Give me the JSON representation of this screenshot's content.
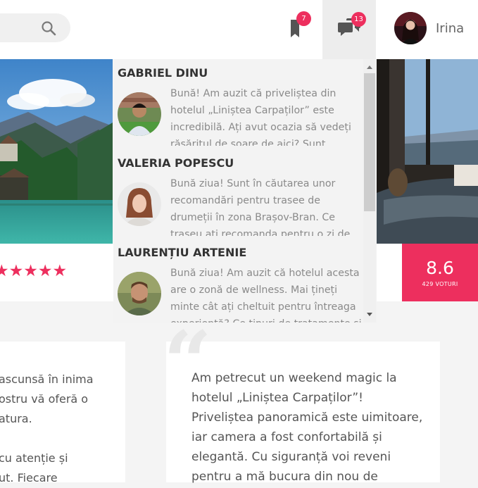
{
  "header": {
    "search_placeholder": "",
    "bookmarks_count": "7",
    "messages_count": "13",
    "user_name": "Irina",
    "accent_color": "#ed2f5e"
  },
  "hotel_card": {
    "rating_stars": "★★★★★",
    "stars_value": 5,
    "score": "8.6",
    "votes": "429 VOTURI"
  },
  "messages": [
    {
      "name": "GABRIEL DINU",
      "text": "Bună! Am auzit că priveliștea din hotelul „Liniștea Carpaților” este incredibilă. Ați avut ocazia să vedeți răsăritul de soare de aici? Sunt indecis"
    },
    {
      "name": "VALERIA POPESCU",
      "text": "Bună ziua! Sunt în căutarea unor recomandări pentru trasee de drumeții în zona Brașov-Bran. Ce traseu ați recomanda pentru o zi de"
    },
    {
      "name": "LAURENȚIU ARTENIE",
      "text": "Bună ziua! Am auzit că hotelul acesta are o zonă de wellness. Mai țineți minte cât ați cheltuit pentru întreaga experiență? Ce tipuri de tratamente și"
    }
  ],
  "reviews": {
    "left_lines": [
      "ascunsă în inima",
      "ostru vă oferă o",
      "atura.",
      "",
      "cu atenție și",
      "ut. Fiecare"
    ],
    "right_text": "Am petrecut un weekend magic la hotelul „Liniștea Carpaților”! Priveliștea panoramică este uimitoare, iar camera a fost confortabilă și elegantă. Cu siguranță voi reveni pentru a mă bucura din nou de"
  },
  "icons": [
    "search-icon",
    "bookmark-icon",
    "chat-icon",
    "scroll-up-icon",
    "scroll-down-icon",
    "quote-icon"
  ]
}
